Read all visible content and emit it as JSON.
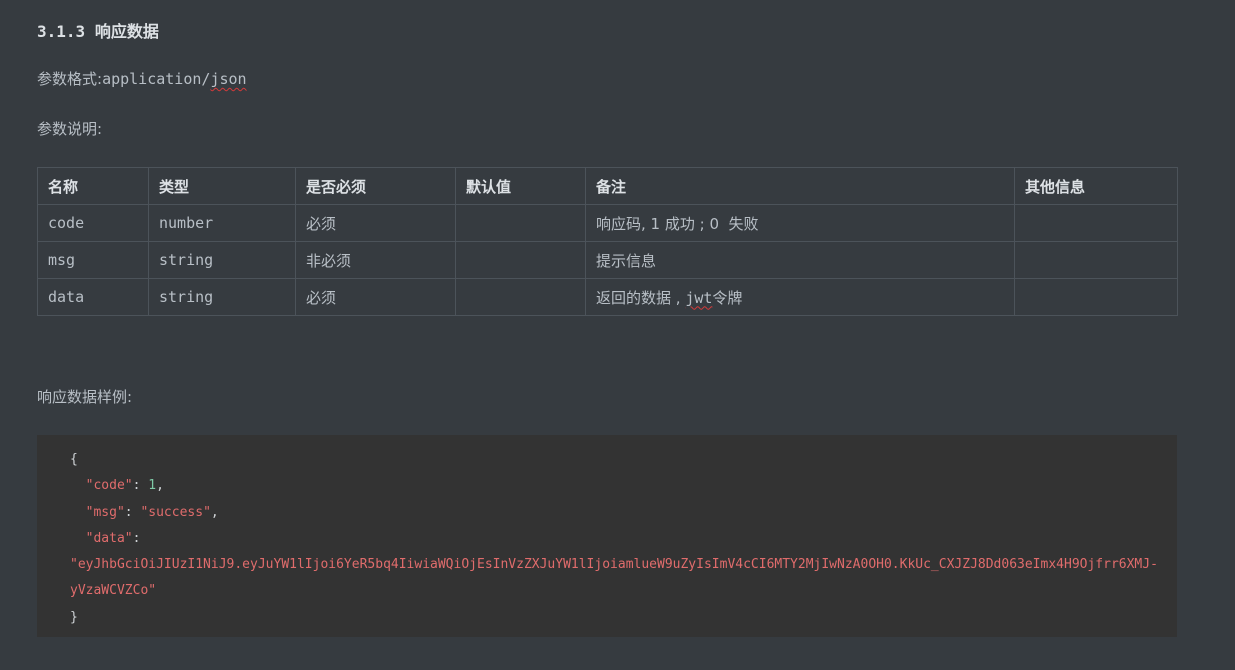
{
  "section": {
    "number": "3.1.3",
    "title": "响应数据"
  },
  "format": {
    "label": "参数格式:",
    "value_prefix": "application/",
    "value_suffix": "json"
  },
  "params_label": "参数说明:",
  "table": {
    "headers": [
      "名称",
      "类型",
      "是否必须",
      "默认值",
      "备注",
      "其他信息"
    ],
    "rows": [
      {
        "name": "code",
        "type": "number",
        "required": "必须",
        "default": "",
        "note": "响应码, 1 成功 ; 0  失败",
        "other": ""
      },
      {
        "name": "msg",
        "type": "string",
        "required": "非必须",
        "default": "",
        "note": "提示信息",
        "other": ""
      },
      {
        "name": "data",
        "type": "string",
        "required": "必须",
        "default": "",
        "note_prefix": "返回的数据 , ",
        "note_squiggle": "jwt",
        "note_suffix": "令牌",
        "other": ""
      }
    ]
  },
  "sample_label": "响应数据样例:",
  "sample": {
    "open_brace": "{",
    "close_brace": "}",
    "code_key": "\"code\"",
    "code_value": "1",
    "msg_key": "\"msg\"",
    "msg_value": "\"success\"",
    "data_key": "\"data\"",
    "data_value": "\"eyJhbGciOiJIUzI1NiJ9.eyJuYW1lIjoi6YeR5bq4IiwiaWQiOjEsInVzZXJuYW1lIjoiamlueW9uZyIsImV4cCI6MTY2MjIwNzA0OH0.KkUc_CXJZJ8Dd063eImx4H9Ojfrr6XMJ-yVzaWCVZCo\""
  },
  "colors": {
    "background": "#363b40",
    "code_background": "#333333",
    "string": "#e06c6c",
    "number": "#7ec9a6",
    "spellcheck": "#d43a3a"
  }
}
